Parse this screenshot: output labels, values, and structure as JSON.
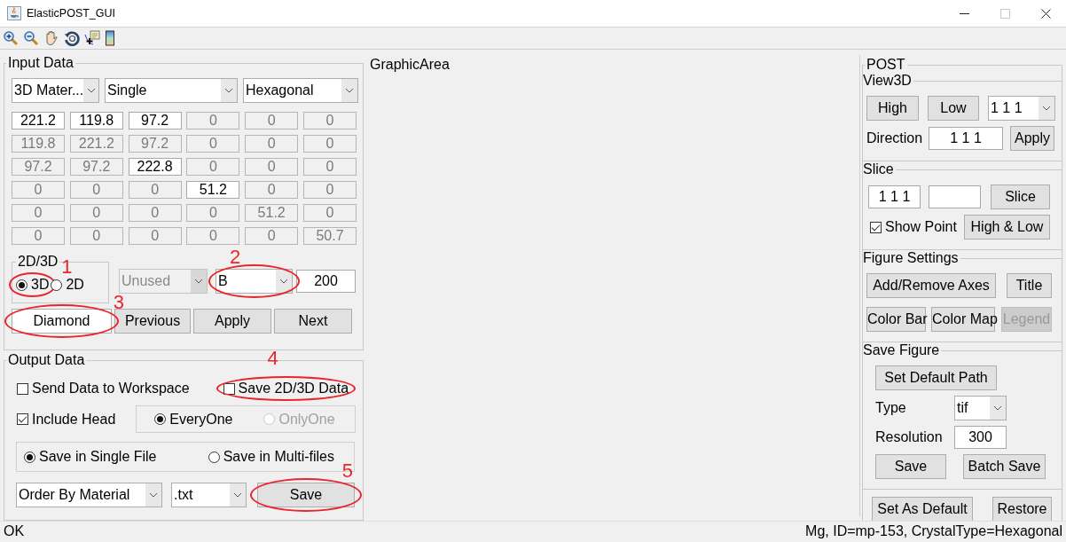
{
  "window": {
    "title": "ElasticPOST_GUI"
  },
  "toolbar": [
    {
      "kind": "zoom-in"
    },
    {
      "kind": "zoom-out"
    },
    {
      "kind": "pan"
    },
    {
      "kind": "rotate"
    },
    {
      "kind": "data-cursor"
    },
    {
      "kind": "colorbar"
    }
  ],
  "input_data": {
    "title": "Input Data",
    "selectors": [
      {
        "value": "3D Mater..."
      },
      {
        "value": "Single"
      },
      {
        "value": "Hexagonal"
      }
    ],
    "matrix": [
      [
        {
          "value": "221.2",
          "editable": true
        },
        {
          "value": "119.8",
          "editable": true
        },
        {
          "value": "97.2",
          "editable": true
        },
        {
          "value": "0",
          "editable": false
        },
        {
          "value": "0",
          "editable": false
        },
        {
          "value": "0",
          "editable": false
        }
      ],
      [
        {
          "value": "119.8",
          "editable": false
        },
        {
          "value": "221.2",
          "editable": false
        },
        {
          "value": "97.2",
          "editable": false
        },
        {
          "value": "0",
          "editable": false
        },
        {
          "value": "0",
          "editable": false
        },
        {
          "value": "0",
          "editable": false
        }
      ],
      [
        {
          "value": "97.2",
          "editable": false
        },
        {
          "value": "97.2",
          "editable": false
        },
        {
          "value": "222.8",
          "editable": true
        },
        {
          "value": "0",
          "editable": false
        },
        {
          "value": "0",
          "editable": false
        },
        {
          "value": "0",
          "editable": false
        }
      ],
      [
        {
          "value": "0",
          "editable": false
        },
        {
          "value": "0",
          "editable": false
        },
        {
          "value": "0",
          "editable": false
        },
        {
          "value": "51.2",
          "editable": true
        },
        {
          "value": "0",
          "editable": false
        },
        {
          "value": "0",
          "editable": false
        }
      ],
      [
        {
          "value": "0",
          "editable": false
        },
        {
          "value": "0",
          "editable": false
        },
        {
          "value": "0",
          "editable": false
        },
        {
          "value": "0",
          "editable": false
        },
        {
          "value": "51.2",
          "editable": false
        },
        {
          "value": "0",
          "editable": false
        }
      ],
      [
        {
          "value": "0",
          "editable": false
        },
        {
          "value": "0",
          "editable": false
        },
        {
          "value": "0",
          "editable": false
        },
        {
          "value": "0",
          "editable": false
        },
        {
          "value": "0",
          "editable": false
        },
        {
          "value": "50.7",
          "editable": false
        }
      ]
    ],
    "dimension": {
      "title": "2D/3D",
      "options": [
        {
          "label": "3D",
          "selected": true,
          "callout": "1"
        },
        {
          "label": "2D",
          "selected": false
        }
      ]
    },
    "unused": {
      "value": "Unused",
      "disabled": true
    },
    "property": {
      "value": "B",
      "callout": "2"
    },
    "count": "200",
    "buttons": [
      {
        "label": "Diamond",
        "kind": "flat",
        "callout": "3"
      },
      {
        "label": "Previous",
        "kind": "raised"
      },
      {
        "label": "Apply",
        "kind": "raised"
      },
      {
        "label": "Next",
        "kind": "raised"
      }
    ]
  },
  "output_data": {
    "title": "Output Data",
    "send_to_workspace": {
      "label": "Send Data to Workspace",
      "checked": false
    },
    "save_data": {
      "label": "Save 2D/3D Data",
      "checked": false,
      "callout": "4"
    },
    "include_head": {
      "label": "Include Head",
      "checked": true
    },
    "head_mode": [
      {
        "label": "EveryOne",
        "selected": true,
        "disabled": false
      },
      {
        "label": "OnlyOne",
        "selected": false,
        "disabled": true
      }
    ],
    "file_mode": [
      {
        "label": "Save in Single File",
        "selected": true
      },
      {
        "label": "Save in Multi-files",
        "selected": false
      }
    ],
    "order": "Order By Material",
    "format": ".txt",
    "save": {
      "label": "Save",
      "callout": "5"
    }
  },
  "graphic_area": {
    "title": "GraphicArea"
  },
  "post": {
    "title": "POST",
    "view3d": {
      "title": "View3D",
      "high": "High",
      "low": "Low",
      "direction_select": "1 1 1",
      "direction_label": "Direction",
      "direction_value": "1 1 1",
      "apply": "Apply"
    },
    "slice": {
      "title": "Slice",
      "plane": "1 1 1",
      "button": "Slice",
      "show_point": {
        "label": "Show Point",
        "checked": true
      },
      "high_low": "High & Low"
    },
    "figure_settings": {
      "title": "Figure Settings",
      "buttons": [
        {
          "label": "Add/Remove Axes",
          "disabled": false
        },
        {
          "label": "Title",
          "disabled": false
        },
        {
          "label": "Color Bar",
          "disabled": false
        },
        {
          "label": "Color Map",
          "disabled": false
        },
        {
          "label": "Legend",
          "disabled": true
        }
      ]
    },
    "save_figure": {
      "title": "Save Figure",
      "default_path": "Set Default Path",
      "type_label": "Type",
      "type": "tif",
      "resolution_label": "Resolution",
      "resolution": "300",
      "save": "Save",
      "batch_save": "Batch Save"
    },
    "set_default": "Set As Default",
    "restore": "Restore"
  },
  "status_bar": {
    "left": "OK",
    "right": "Mg, ID=mp-153, CrystalType=Hexagonal"
  }
}
